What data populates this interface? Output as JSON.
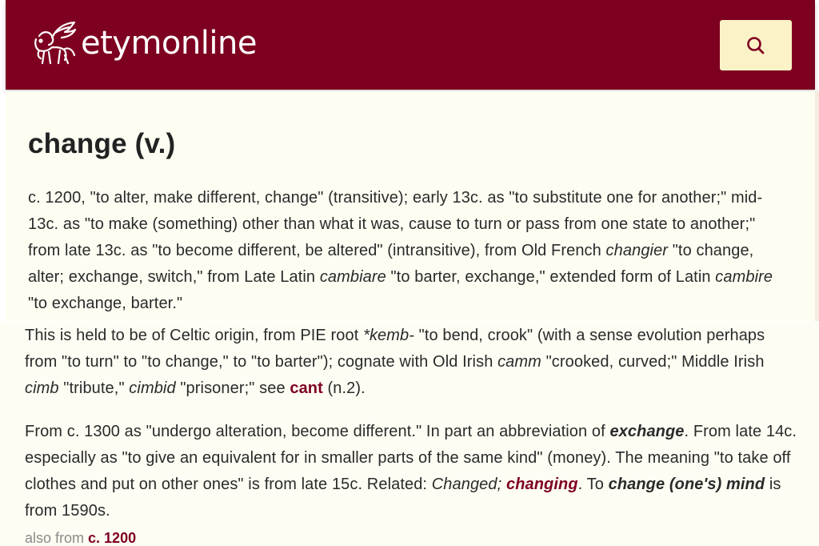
{
  "header": {
    "logo_text": "etymonline",
    "logo_icon": "winged-lion-icon",
    "search_icon": "search-icon",
    "colors": {
      "bar": "#7e0020",
      "search_button": "#fbf2c7"
    }
  },
  "entry": {
    "title": "change (v.)",
    "p1": {
      "t1": "c. 1200, \"to alter, make different, change\" (transitive); early 13c. as \"to substitute one for another;\" mid-13c. as \"to make (something) other than what it was, cause to turn or pass from one state to another;\" from late 13c. as \"to become different, be altered\" (intransitive), from Old French ",
      "i1": "changier",
      "t2": " \"to change, alter; exchange, switch,\" from Late Latin ",
      "i2": "cambiare",
      "t3": " \"to barter, exchange,\" extended form of Latin ",
      "i3": "cambire",
      "t4": " \"to exchange, barter.\""
    },
    "p2": {
      "t1": "This is held to be of Celtic origin, from PIE root ",
      "i1": "*kemb-",
      "t2": " \"to bend, crook\" (with a sense evolution perhaps from \"to turn\" to \"to change,\" to \"to barter\"); cognate with Old Irish ",
      "i2": "camm",
      "t3": " \"crooked, curved;\" Middle Irish ",
      "i3": "cimb",
      "t4": " \"tribute,\" ",
      "i4": "cimbid",
      "t5": " \"prisoner;\" see ",
      "link": "cant",
      "t6": " (n.2)."
    },
    "p3": {
      "t1": "From c. 1300 as \"undergo alteration, become different.\" In part an abbreviation of ",
      "bi1": "exchange",
      "t2": ". From late 14c. especially as \"to give an equivalent for in smaller parts of the same kind\" (money). The meaning \"to take off clothes and put on other ones\" is from late 15c. Related: ",
      "i1": "Changed;",
      "t3": " ",
      "link": "changing",
      "t4": ". To ",
      "bi2": "change (one's) mind",
      "t5": " is from 1590s."
    },
    "also_from": {
      "label": "also from ",
      "link": "c. 1200"
    }
  }
}
